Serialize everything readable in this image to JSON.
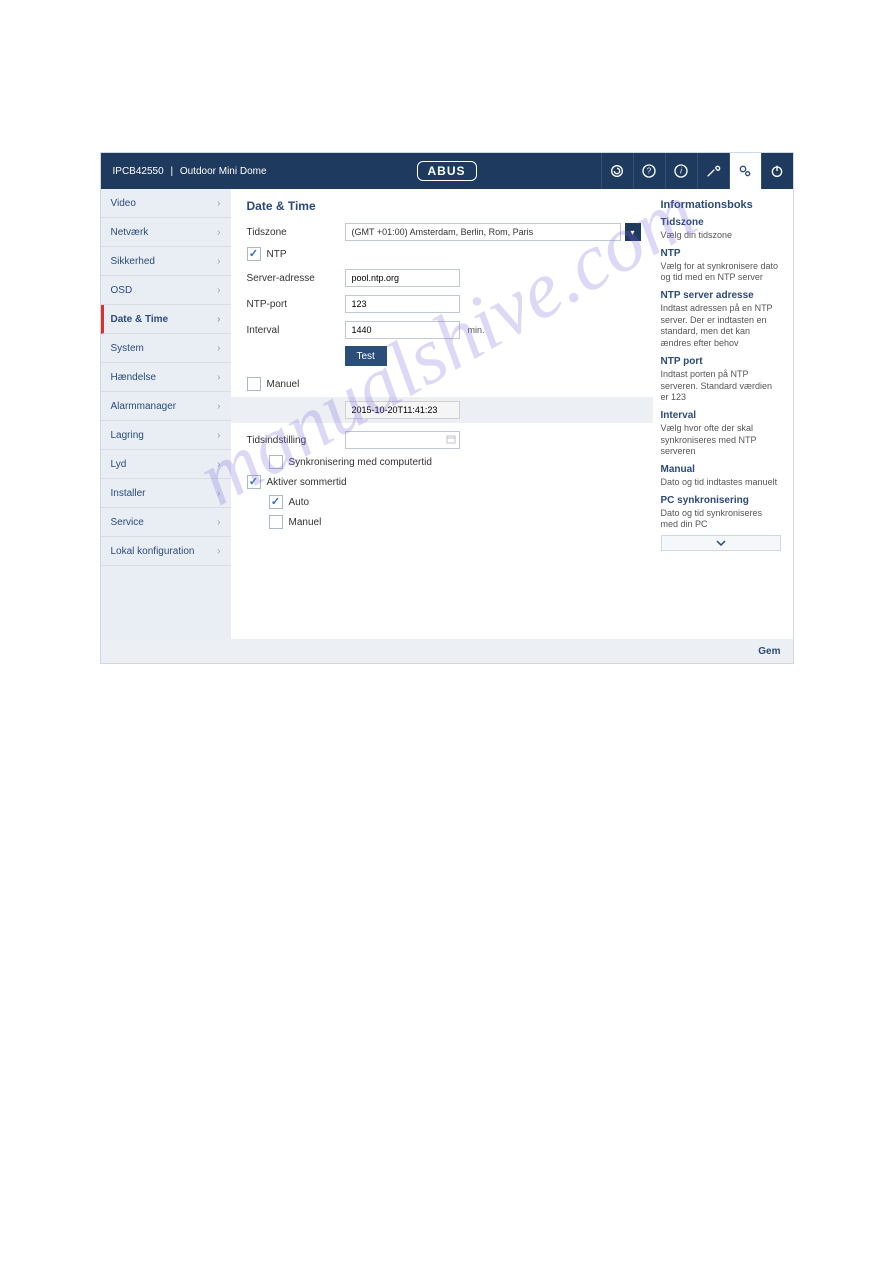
{
  "header": {
    "device_id": "IPCB42550",
    "separator": "|",
    "device_name": "Outdoor Mini Dome",
    "logo": "ABUS"
  },
  "header_icons": [
    "refresh-icon",
    "help-icon",
    "info-icon",
    "tools-icon",
    "settings-icon",
    "power-icon"
  ],
  "sidebar": {
    "items": [
      {
        "label": "Video"
      },
      {
        "label": "Netværk"
      },
      {
        "label": "Sikkerhed"
      },
      {
        "label": "OSD"
      },
      {
        "label": "Date & Time",
        "active": true
      },
      {
        "label": "System"
      },
      {
        "label": "Hændelse"
      },
      {
        "label": "Alarmmanager"
      },
      {
        "label": "Lagring"
      },
      {
        "label": "Lyd"
      },
      {
        "label": "Installer"
      },
      {
        "label": "Service"
      },
      {
        "label": "Lokal konfiguration"
      }
    ]
  },
  "page": {
    "title": "Date & Time",
    "timezone_label": "Tidszone",
    "timezone_value": "(GMT +01:00) Amsterdam, Berlin, Rom, Paris",
    "ntp_label": "NTP",
    "ntp_checked": true,
    "server_label": "Server-adresse",
    "server_value": "pool.ntp.org",
    "port_label": "NTP-port",
    "port_value": "123",
    "interval_label": "Interval",
    "interval_value": "1440",
    "interval_unit": "min.",
    "test_button": "Test",
    "manual_label": "Manuel",
    "manual_checked": false,
    "manual_time_value": "2015-10-20T11:41:23",
    "tidsindstilling_label": "Tidsindstilling",
    "tidsindstilling_value": "",
    "sync_pc_label": "Synkronisering med computertid",
    "sync_pc_checked": false,
    "dst_label": "Aktiver sommertid",
    "dst_checked": true,
    "dst_auto_label": "Auto",
    "dst_auto_checked": true,
    "dst_manual_label": "Manuel",
    "dst_manual_checked": false
  },
  "info": {
    "title": "Informationsboks",
    "sections": [
      {
        "heading": "Tidszone",
        "text": "Vælg din tidszone"
      },
      {
        "heading": "NTP",
        "text": "Vælg for at synkronisere dato og tid med en NTP server"
      },
      {
        "heading": "NTP server adresse",
        "text": "Indtast adressen på en NTP server.\nDer er indtasten en standard, men det kan ændres efter behov"
      },
      {
        "heading": "NTP port",
        "text": "Indtast porten på NTP serveren. Standard værdien er 123"
      },
      {
        "heading": "Interval",
        "text": "Vælg hvor ofte der skal synkroniseres med NTP serveren"
      },
      {
        "heading": "Manual",
        "text": "Dato og tid indtastes manuelt"
      },
      {
        "heading": "PC synkronisering",
        "text": "Dato og tid synkroniseres med din PC"
      }
    ]
  },
  "footer": {
    "save": "Gem"
  },
  "watermark": "manualshive.com"
}
